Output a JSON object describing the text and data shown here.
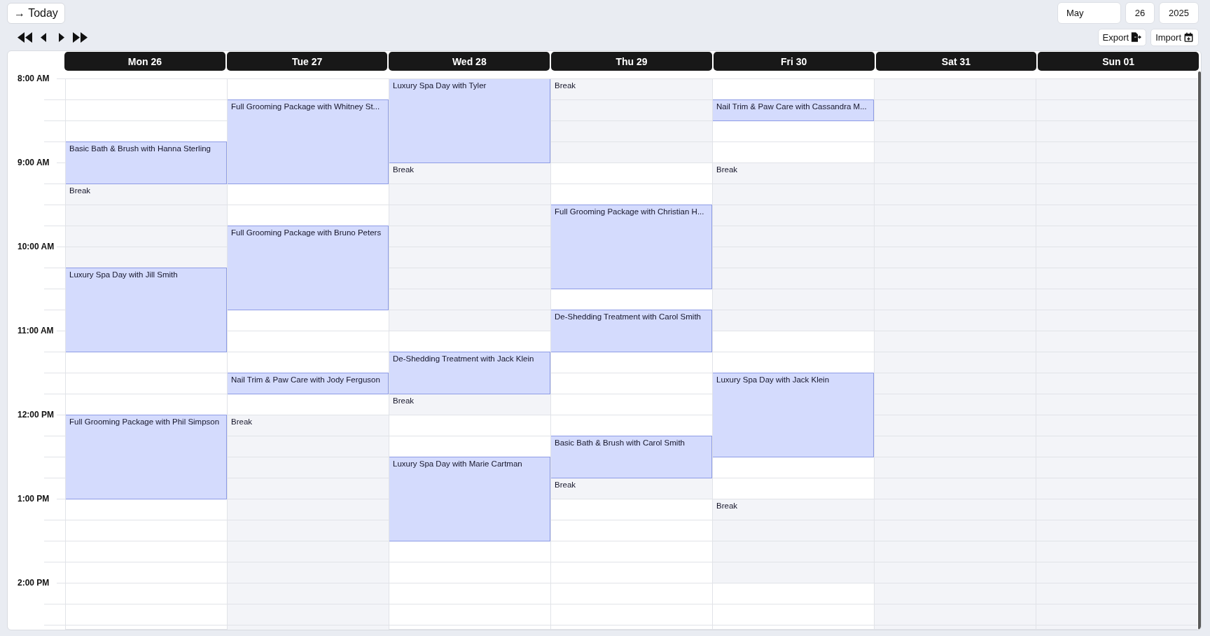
{
  "toolbar": {
    "today_button": "→ Today",
    "date_fields": [
      {
        "kind": "month",
        "value": "May"
      },
      {
        "kind": "day",
        "value": "26"
      },
      {
        "kind": "year",
        "value": "2025"
      }
    ],
    "actions": [
      {
        "kind": "export",
        "label": "Export"
      },
      {
        "kind": "import",
        "label": "Import"
      }
    ]
  },
  "calendar": {
    "time_labels": [
      "8:00 AM",
      "9:00 AM",
      "10:00 AM",
      "11:00 AM",
      "12:00 PM",
      "1:00 PM",
      "2:00 PM"
    ],
    "days": [
      {
        "label": "Mon 26",
        "available": true,
        "slots": [
          {
            "kind": "open"
          },
          {
            "kind": "open"
          },
          {
            "kind": "open"
          },
          {
            "kind": "appointment",
            "title": "Basic Bath & Brush with Hanna Sterling"
          },
          {
            "kind": "continued"
          },
          {
            "kind": "break",
            "title": "Break"
          },
          {
            "kind": "continued"
          },
          {
            "kind": "continued"
          },
          {
            "kind": "continued"
          },
          {
            "kind": "appointment",
            "title": "Luxury Spa Day with Jill Smith"
          },
          {
            "kind": "continued"
          },
          {
            "kind": "continued"
          },
          {
            "kind": "continued"
          },
          {
            "kind": "open"
          },
          {
            "kind": "open"
          },
          {
            "kind": "open"
          },
          {
            "kind": "appointment",
            "title": "Full Grooming Package with Phil Simpson"
          },
          {
            "kind": "continued"
          },
          {
            "kind": "continued"
          },
          {
            "kind": "continued"
          },
          {
            "kind": "open"
          },
          {
            "kind": "open"
          },
          {
            "kind": "open"
          },
          {
            "kind": "open"
          },
          {
            "kind": "open"
          },
          {
            "kind": "open"
          },
          {
            "kind": "open"
          }
        ]
      },
      {
        "label": "Tue 27",
        "available": true,
        "slots": [
          {
            "kind": "open"
          },
          {
            "kind": "appointment",
            "title": "Full Grooming Package with Whitney St..."
          },
          {
            "kind": "continued"
          },
          {
            "kind": "continued"
          },
          {
            "kind": "continued"
          },
          {
            "kind": "open"
          },
          {
            "kind": "open"
          },
          {
            "kind": "appointment",
            "title": "Full Grooming Package with Bruno Peters"
          },
          {
            "kind": "continued"
          },
          {
            "kind": "continued"
          },
          {
            "kind": "continued"
          },
          {
            "kind": "open"
          },
          {
            "kind": "open"
          },
          {
            "kind": "open"
          },
          {
            "kind": "appointment",
            "title": "Nail Trim & Paw Care with Jody Ferguson"
          },
          {
            "kind": "open"
          },
          {
            "kind": "break",
            "title": "Break"
          },
          {
            "kind": "continued"
          },
          {
            "kind": "continued"
          },
          {
            "kind": "continued"
          },
          {
            "kind": "continued"
          },
          {
            "kind": "continued"
          },
          {
            "kind": "continued"
          },
          {
            "kind": "continued"
          },
          {
            "kind": "continued"
          },
          {
            "kind": "continued"
          },
          {
            "kind": "continued"
          }
        ]
      },
      {
        "label": "Wed 28",
        "available": true,
        "slots": [
          {
            "kind": "appointment",
            "title": "Luxury Spa Day with Tyler"
          },
          {
            "kind": "continued"
          },
          {
            "kind": "continued"
          },
          {
            "kind": "continued"
          },
          {
            "kind": "break",
            "title": "Break"
          },
          {
            "kind": "continued"
          },
          {
            "kind": "continued"
          },
          {
            "kind": "continued"
          },
          {
            "kind": "continued"
          },
          {
            "kind": "continued"
          },
          {
            "kind": "continued"
          },
          {
            "kind": "continued"
          },
          {
            "kind": "open"
          },
          {
            "kind": "appointment",
            "title": "De-Shedding Treatment with Jack Klein"
          },
          {
            "kind": "continued"
          },
          {
            "kind": "break",
            "title": "Break"
          },
          {
            "kind": "open"
          },
          {
            "kind": "open"
          },
          {
            "kind": "appointment",
            "title": "Luxury Spa Day with Marie Cartman"
          },
          {
            "kind": "continued"
          },
          {
            "kind": "continued"
          },
          {
            "kind": "continued"
          },
          {
            "kind": "open"
          },
          {
            "kind": "open"
          },
          {
            "kind": "open"
          },
          {
            "kind": "open"
          },
          {
            "kind": "open"
          }
        ]
      },
      {
        "label": "Thu 29",
        "available": true,
        "slots": [
          {
            "kind": "break",
            "title": "Break"
          },
          {
            "kind": "continued"
          },
          {
            "kind": "continued"
          },
          {
            "kind": "continued"
          },
          {
            "kind": "open"
          },
          {
            "kind": "open"
          },
          {
            "kind": "appointment",
            "title": "Full Grooming Package with Christian H..."
          },
          {
            "kind": "continued"
          },
          {
            "kind": "continued"
          },
          {
            "kind": "continued"
          },
          {
            "kind": "open"
          },
          {
            "kind": "appointment",
            "title": "De-Shedding Treatment with Carol Smith"
          },
          {
            "kind": "continued"
          },
          {
            "kind": "open"
          },
          {
            "kind": "open"
          },
          {
            "kind": "open"
          },
          {
            "kind": "open"
          },
          {
            "kind": "appointment",
            "title": "Basic Bath & Brush with Carol Smith"
          },
          {
            "kind": "continued"
          },
          {
            "kind": "break",
            "title": "Break"
          },
          {
            "kind": "open"
          },
          {
            "kind": "open"
          },
          {
            "kind": "open"
          },
          {
            "kind": "open"
          },
          {
            "kind": "open"
          },
          {
            "kind": "open"
          },
          {
            "kind": "open"
          }
        ]
      },
      {
        "label": "Fri 30",
        "available": true,
        "slots": [
          {
            "kind": "open"
          },
          {
            "kind": "appointment",
            "title": "Nail Trim & Paw Care with Cassandra M..."
          },
          {
            "kind": "open"
          },
          {
            "kind": "open"
          },
          {
            "kind": "break",
            "title": "Break"
          },
          {
            "kind": "continued"
          },
          {
            "kind": "continued"
          },
          {
            "kind": "continued"
          },
          {
            "kind": "continued"
          },
          {
            "kind": "continued"
          },
          {
            "kind": "continued"
          },
          {
            "kind": "continued"
          },
          {
            "kind": "open"
          },
          {
            "kind": "open"
          },
          {
            "kind": "appointment",
            "title": "Luxury Spa Day with Jack Klein"
          },
          {
            "kind": "continued"
          },
          {
            "kind": "continued"
          },
          {
            "kind": "continued"
          },
          {
            "kind": "open"
          },
          {
            "kind": "open"
          },
          {
            "kind": "break",
            "title": "Break"
          },
          {
            "kind": "continued"
          },
          {
            "kind": "continued"
          },
          {
            "kind": "continued"
          },
          {
            "kind": "open"
          },
          {
            "kind": "open"
          },
          {
            "kind": "open"
          }
        ]
      },
      {
        "label": "Sat 31",
        "available": false
      },
      {
        "label": "Sun 01",
        "available": false
      }
    ]
  }
}
